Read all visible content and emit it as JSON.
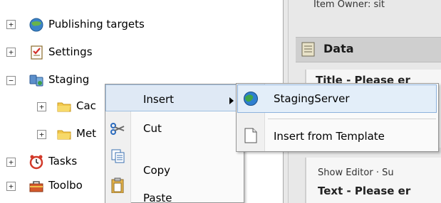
{
  "tree": {
    "items": [
      {
        "label": "Publishing targets",
        "expander": "+",
        "icon": "globe-publishing-icon"
      },
      {
        "label": "Settings",
        "expander": "+",
        "icon": "settings-checklist-icon"
      },
      {
        "label": "Staging",
        "expander": "−",
        "icon": "staging-servers-icon"
      },
      {
        "label": "Cac",
        "expander": "+",
        "icon": "folder-icon"
      },
      {
        "label": "Met",
        "expander": "+",
        "icon": "folder-icon"
      },
      {
        "label": "Tasks",
        "expander": "+",
        "icon": "alarm-clock-icon"
      },
      {
        "label": "Toolbo",
        "expander": "+",
        "icon": "toolbox-icon"
      }
    ]
  },
  "right_panel": {
    "top_text": "Item Owner: sit",
    "section_title": "Data",
    "field_title": "Title - Please er",
    "show_editor": "Show Editor · Su",
    "text_field": "Text - Please er"
  },
  "context_menu": {
    "items": [
      {
        "label": "Insert",
        "icon": "",
        "has_submenu": true
      },
      {
        "label": "Cut",
        "icon": "scissors-icon"
      },
      {
        "label": "Copy",
        "icon": "copy-icon"
      },
      {
        "label": "Paste",
        "icon": "paste-icon"
      }
    ]
  },
  "submenu": {
    "items": [
      {
        "label": "StagingServer",
        "icon": "globe-icon"
      },
      {
        "label": "Insert from Template",
        "icon": "blank-page-icon"
      }
    ]
  },
  "colors": {
    "highlight": "#dfe9f5",
    "highlight_border": "#9fbfe0",
    "panel_bg": "#e8e8e8"
  }
}
